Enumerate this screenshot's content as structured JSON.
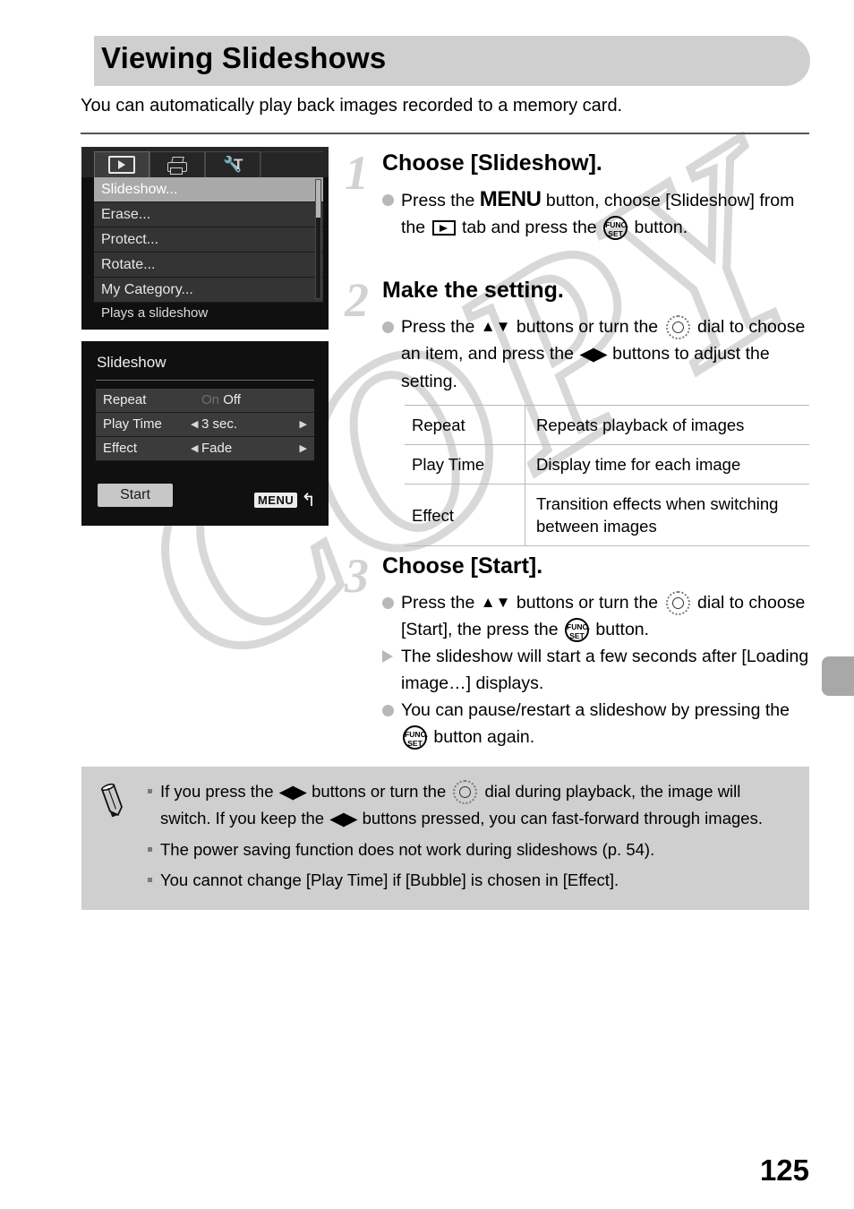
{
  "page": {
    "title": "Viewing Slideshows",
    "intro": "You can automatically play back images recorded to a memory card.",
    "number": "125",
    "watermark": "COPY"
  },
  "screens": {
    "menu": {
      "tabs": [
        "playback-tab-icon",
        "print-tab-icon",
        "settings-tab-icon"
      ],
      "items": [
        {
          "label": "Slideshow...",
          "selected": true
        },
        {
          "label": "Erase...",
          "selected": false
        },
        {
          "label": "Protect...",
          "selected": false
        },
        {
          "label": "Rotate...",
          "selected": false
        },
        {
          "label": "My Category...",
          "selected": false
        }
      ],
      "hint": "Plays a slideshow"
    },
    "slideshow": {
      "title": "Slideshow",
      "rows": [
        {
          "label": "Repeat",
          "value_dim": "On",
          "value": "Off",
          "arrows": false
        },
        {
          "label": "Play Time",
          "value": "3 sec.",
          "arrows": true
        },
        {
          "label": "Effect",
          "value": "Fade",
          "arrows": true
        }
      ],
      "start_label": "Start",
      "menu_badge": "MENU",
      "return_glyph": "↰"
    }
  },
  "steps": [
    {
      "num": "1",
      "heading": "Choose [Slideshow].",
      "lines": [
        {
          "bullet": "dot",
          "parts": [
            {
              "t": "text",
              "v": "Press the "
            },
            {
              "t": "menu"
            },
            {
              "t": "text",
              "v": " button, choose [Slideshow] from the "
            },
            {
              "t": "playtab"
            },
            {
              "t": "text",
              "v": " tab and press the "
            },
            {
              "t": "func"
            },
            {
              "t": "text",
              "v": " button."
            }
          ]
        }
      ]
    },
    {
      "num": "2",
      "heading": "Make the setting.",
      "lines": [
        {
          "bullet": "dot",
          "parts": [
            {
              "t": "text",
              "v": "Press the "
            },
            {
              "t": "updown"
            },
            {
              "t": "text",
              "v": " buttons or turn the "
            },
            {
              "t": "dial"
            },
            {
              "t": "text",
              "v": " dial to choose an item, and press the "
            },
            {
              "t": "leftright"
            },
            {
              "t": "text",
              "v": " buttons to adjust the setting."
            }
          ]
        }
      ]
    },
    {
      "num": "3",
      "heading": "Choose [Start].",
      "lines": [
        {
          "bullet": "dot",
          "parts": [
            {
              "t": "text",
              "v": "Press the "
            },
            {
              "t": "updown"
            },
            {
              "t": "text",
              "v": " buttons or turn the "
            },
            {
              "t": "dial"
            },
            {
              "t": "text",
              "v": " dial to choose [Start], the press the "
            },
            {
              "t": "func"
            },
            {
              "t": "text",
              "v": " button."
            }
          ]
        },
        {
          "bullet": "tri",
          "parts": [
            {
              "t": "text",
              "v": "The slideshow will start a few seconds after [Loading image…] displays."
            }
          ]
        },
        {
          "bullet": "dot",
          "parts": [
            {
              "t": "text",
              "v": "You can pause/restart a slideshow by pressing the "
            },
            {
              "t": "func"
            },
            {
              "t": "text",
              "v": " button again."
            }
          ]
        }
      ]
    }
  ],
  "table": {
    "rows": [
      {
        "name": "Repeat",
        "desc": "Repeats playback of images"
      },
      {
        "name": "Play Time",
        "desc": "Display time for each image"
      },
      {
        "name": "Effect",
        "desc": "Transition effects when switching between images"
      }
    ]
  },
  "note": {
    "items": [
      {
        "parts": [
          {
            "t": "text",
            "v": "If you press the "
          },
          {
            "t": "leftright"
          },
          {
            "t": "text",
            "v": " buttons or turn the "
          },
          {
            "t": "dial"
          },
          {
            "t": "text",
            "v": " dial during playback, the image will switch. If you keep the "
          },
          {
            "t": "leftright"
          },
          {
            "t": "text",
            "v": " buttons pressed, you can fast-forward through images."
          }
        ]
      },
      {
        "parts": [
          {
            "t": "text",
            "v": "The power saving function does not work during slideshows (p. 54)."
          }
        ]
      },
      {
        "parts": [
          {
            "t": "text",
            "v": "You cannot change [Play Time] if [Bubble] is chosen in [Effect]."
          }
        ]
      }
    ]
  },
  "glyphs": {
    "menu_label": "MENU",
    "func_top": "FUNC.",
    "func_bottom": "SET",
    "updown": "▲▼",
    "leftright": "◀▶"
  },
  "colors": {
    "title_bg": "#cfcfcf",
    "note_bg": "#cfcfcf",
    "screen_bg": "#101010",
    "step_num": "#d2d2d2",
    "watermark": "#d8d8d8"
  }
}
